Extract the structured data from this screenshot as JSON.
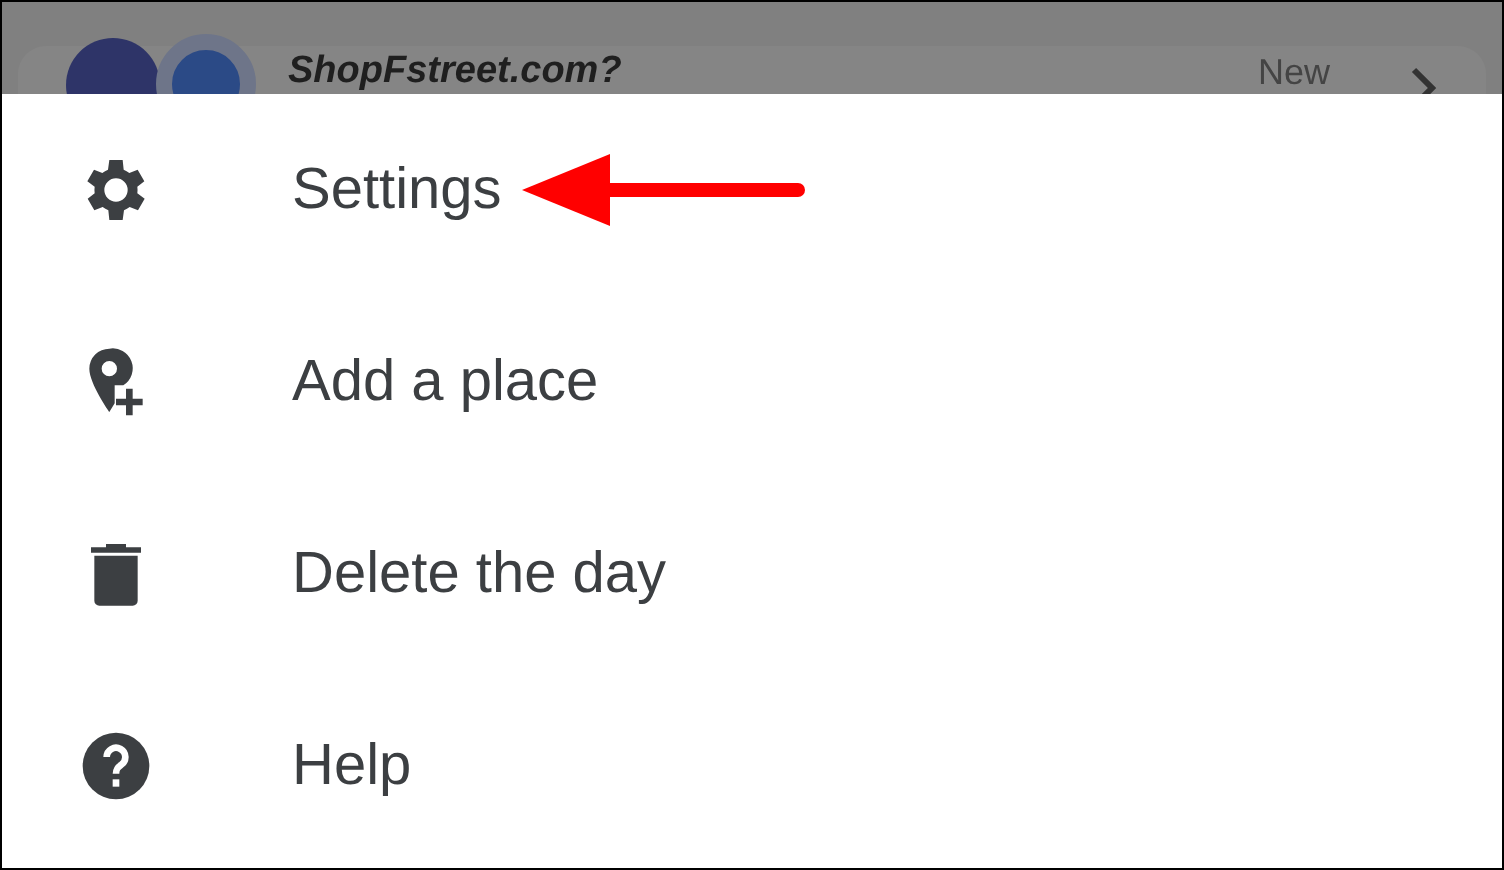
{
  "background_item": {
    "title": "ShopFstreet.com?",
    "action": "New"
  },
  "menu": [
    {
      "kind": "settings",
      "label": "Settings",
      "pointed": true
    },
    {
      "kind": "add-place",
      "label": "Add a place",
      "pointed": false
    },
    {
      "kind": "delete",
      "label": "Delete the day",
      "pointed": false
    },
    {
      "kind": "help",
      "label": "Help",
      "pointed": false
    }
  ]
}
